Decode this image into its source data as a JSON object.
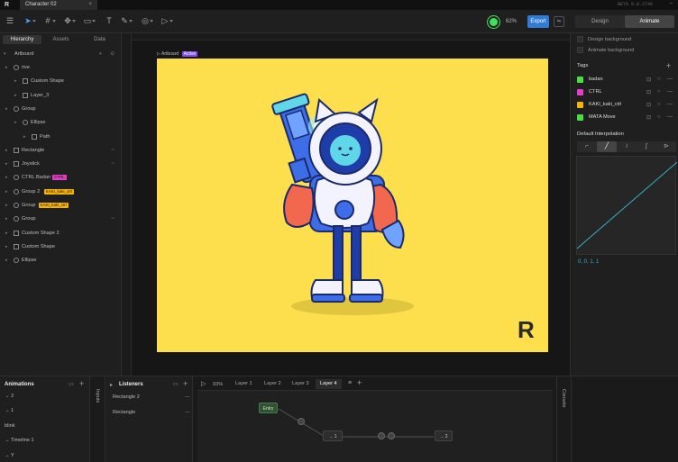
{
  "titlebar": {
    "logo": "R",
    "doc_tab": "Character 02",
    "close": "×",
    "beta": "BETA 0.8.2746",
    "minimize": "–"
  },
  "toolbar": {
    "menu_icon": "hamburger-icon",
    "zoom": "62%",
    "export_label": "Export",
    "mode_tabs": [
      "Design",
      "Animate"
    ],
    "active_mode": "Animate"
  },
  "left_panel": {
    "tabs": [
      "Hierarchy",
      "Assets",
      "Data"
    ],
    "active_tab": "Hierarchy",
    "root": "Artboard",
    "rows": [
      {
        "label": "rive",
        "indent": 0,
        "icon": "root"
      },
      {
        "label": "Custom Shape",
        "indent": 1,
        "icon": "shape"
      },
      {
        "label": "Layer_3",
        "indent": 1,
        "icon": "shape"
      },
      {
        "label": "Group",
        "indent": 0,
        "icon": "group"
      },
      {
        "label": "Ellipse",
        "indent": 1,
        "icon": "ellipse"
      },
      {
        "label": "Path",
        "indent": 2,
        "icon": "path"
      },
      {
        "label": "Rectangle",
        "indent": 0,
        "icon": "rect",
        "trail": "~"
      },
      {
        "label": "Joystick",
        "indent": 0,
        "icon": "joystick",
        "trail": "~"
      },
      {
        "label": "CTRL Badan",
        "indent": 0,
        "icon": "group",
        "tag": "CTRL",
        "tag_color": "#e040c8"
      },
      {
        "label": "Group 2",
        "indent": 0,
        "icon": "group",
        "tag": "KAKI_kaki_ctrl",
        "tag_color": "#f7b500"
      },
      {
        "label": "Group",
        "indent": 0,
        "icon": "group",
        "tag": "KAKI_kaki_ctrl",
        "tag_color": "#f7b500"
      },
      {
        "label": "Group",
        "indent": 0,
        "icon": "group",
        "trail": "~"
      },
      {
        "label": "Custom Shape 2",
        "indent": 0,
        "icon": "shape"
      },
      {
        "label": "Custom Shape",
        "indent": 0,
        "icon": "shape"
      },
      {
        "label": "Ellipse",
        "indent": 0,
        "icon": "ellipse"
      }
    ]
  },
  "canvas": {
    "artboard_label": "Artboard",
    "artboard_badge": "Active",
    "artboard_bg": "#fddf4d",
    "watermark": "R"
  },
  "right_panel": {
    "checkboxes": [
      "Design background",
      "Animate background"
    ],
    "tags_title": "Tags",
    "tags": [
      {
        "name": "badan",
        "color": "#47e03f"
      },
      {
        "name": "CTRL",
        "color": "#e23fce"
      },
      {
        "name": "KAKI_kaki_ctrl",
        "color": "#f7b500"
      },
      {
        "name": "MATA Move",
        "color": "#47e03f"
      }
    ],
    "interp_title": "Default Interpolation",
    "interp_buttons": [
      "⌐",
      "╱",
      "≀",
      "∫",
      "⊳"
    ],
    "interp_selected": 1,
    "curve_values": "0, 0, 1, 1",
    "curve_color": "#34b3c7"
  },
  "bottom": {
    "animations_title": "Animations",
    "animations": [
      "→ 2",
      "→ 1",
      "blink",
      "→ Timeline 1",
      "→ Y"
    ],
    "inputs_label": "Inputs",
    "listeners_title": "Listeners",
    "listeners": [
      "Rectangle 2",
      "Rectangle"
    ],
    "graph_zoom": "93%",
    "layer_tabs": [
      "Layer 1",
      "Layer 2",
      "Layer 3",
      "Layer 4"
    ],
    "active_layer": "Layer 4",
    "console_label": "Console",
    "nodes": {
      "entry": "Entry",
      "state1": "→ 1",
      "state2": "→ 2"
    }
  }
}
